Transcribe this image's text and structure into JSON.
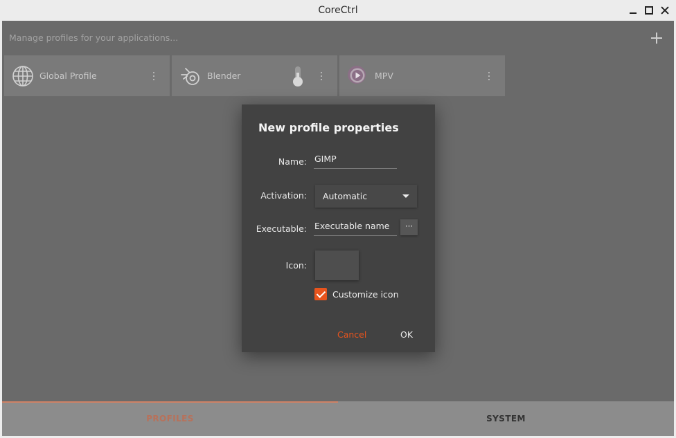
{
  "window": {
    "title": "CoreCtrl"
  },
  "header": {
    "text": "Manage profiles for your applications..."
  },
  "profiles": [
    {
      "name": "Global Profile",
      "icon": "globe-icon"
    },
    {
      "name": "Blender",
      "icon": "blender-icon"
    },
    {
      "name": "MPV",
      "icon": "mpv-icon"
    }
  ],
  "tabs": [
    {
      "label": "PROFILES",
      "active": true
    },
    {
      "label": "SYSTEM",
      "active": false
    }
  ],
  "dialog": {
    "title": "New profile properties",
    "name_label": "Name:",
    "name_value": "GIMP",
    "activation_label": "Activation:",
    "activation_value": "Automatic",
    "executable_label": "Executable:",
    "executable_value": "Executable name",
    "browse_label": "···",
    "icon_label": "Icon:",
    "customize_icon_label": "Customize icon",
    "customize_icon_checked": true,
    "cancel_label": "Cancel",
    "ok_label": "OK"
  },
  "colors": {
    "accent": "#e8541d",
    "dialog_bg": "#424242",
    "overlay_bg": "#6a6a6a"
  }
}
